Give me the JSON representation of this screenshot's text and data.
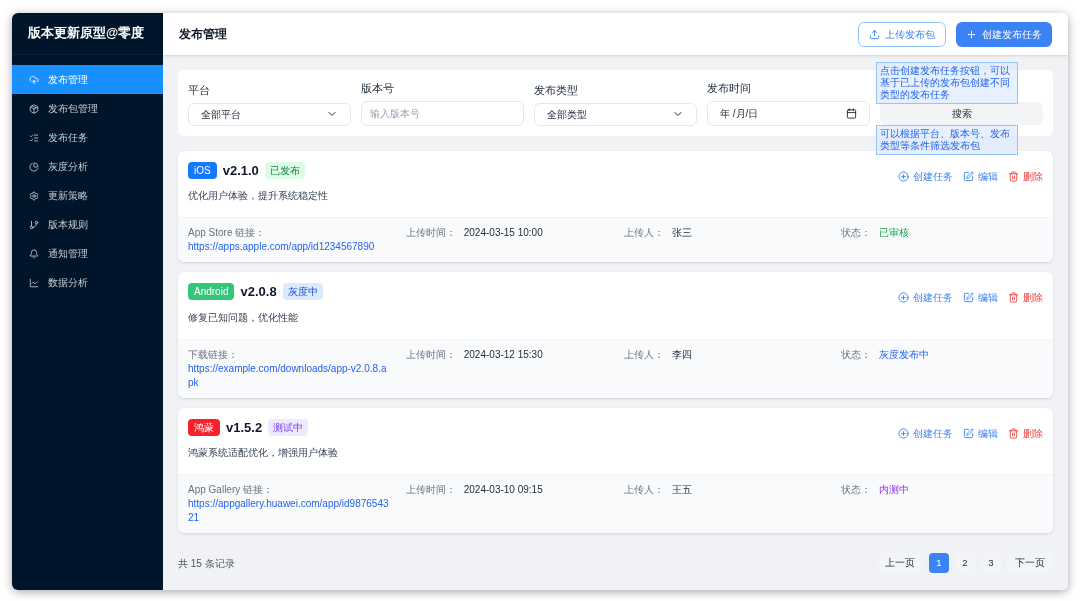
{
  "sidebar": {
    "title": "版本更新原型@零度",
    "items": [
      {
        "label": "发布管理",
        "kind": "upload",
        "selected": true
      },
      {
        "label": "发布包管理",
        "kind": "package",
        "selected": false
      },
      {
        "label": "发布任务",
        "kind": "tasks",
        "selected": false
      },
      {
        "label": "灰度分析",
        "kind": "pie",
        "selected": false
      },
      {
        "label": "更新策略",
        "kind": "gear",
        "selected": false
      },
      {
        "label": "版本规则",
        "kind": "branch",
        "selected": false
      },
      {
        "label": "通知管理",
        "kind": "bell",
        "selected": false
      },
      {
        "label": "数据分析",
        "kind": "chart",
        "selected": false
      }
    ]
  },
  "header": {
    "title": "发布管理",
    "buttons": [
      {
        "label": "上传发布包",
        "kind": "upload"
      },
      {
        "label": "创建发布任务",
        "kind": "create"
      }
    ]
  },
  "filters": {
    "fields": [
      {
        "label": "平台",
        "kind": "select",
        "value": "全部平台"
      },
      {
        "label": "版本号",
        "kind": "input",
        "placeholder": "输入版本号"
      },
      {
        "label": "发布类型",
        "kind": "select",
        "value": "全部类型"
      },
      {
        "label": "发布时间",
        "kind": "date",
        "placeholder": "年 /月/日"
      }
    ],
    "search_button": "搜索"
  },
  "annotations": [
    "点击创建发布任务按钮，可以基于已上传的发布包创建不同类型的发布任务",
    "可以根据平台、版本号、发布类型等条件筛选发布包"
  ],
  "releases": [
    {
      "platform": {
        "text": "iOS",
        "color": "#1677ff"
      },
      "version": "v2.1.0",
      "tag": {
        "text": "已发布",
        "kind": "released"
      },
      "description": "优化用户体验，提升系统稳定性",
      "actions": [
        {
          "label": "创建任务",
          "kind": "create"
        },
        {
          "label": "编辑",
          "kind": "edit"
        },
        {
          "label": "删除",
          "kind": "delete"
        }
      ],
      "link_label": "App Store 链接：",
      "link": "https://apps.apple.com/app/id1234567890",
      "time_label": "上传时间：",
      "time": "2024-03-15 10:00",
      "uploader_label": "上传人：",
      "uploader": "张三",
      "status_label": "状态：",
      "status": {
        "text": "已审核",
        "kind": "released"
      }
    },
    {
      "platform": {
        "text": "Android",
        "color": "#34c77b"
      },
      "version": "v2.0.8",
      "tag": {
        "text": "灰度中",
        "kind": "gray"
      },
      "description": "修复已知问题，优化性能",
      "actions": [
        {
          "label": "创建任务",
          "kind": "create"
        },
        {
          "label": "编辑",
          "kind": "edit"
        },
        {
          "label": "删除",
          "kind": "delete"
        }
      ],
      "link_label": "下载链接：",
      "link": "https://example.com/downloads/app-v2.0.8.apk",
      "time_label": "上传时间：",
      "time": "2024-03-12 15:30",
      "uploader_label": "上传人：",
      "uploader": "李四",
      "status_label": "状态：",
      "status": {
        "text": "灰度发布中",
        "kind": "gray"
      }
    },
    {
      "platform": {
        "text": "鸿蒙",
        "color": "#f5222d"
      },
      "version": "v1.5.2",
      "tag": {
        "text": "测试中",
        "kind": "testing"
      },
      "description": "鸿蒙系统适配优化，增强用户体验",
      "actions": [
        {
          "label": "创建任务",
          "kind": "create"
        },
        {
          "label": "编辑",
          "kind": "edit"
        },
        {
          "label": "删除",
          "kind": "delete"
        }
      ],
      "link_label": "App Gallery 链接：",
      "link": "https://appgallery.huawei.com/app/id987654321",
      "time_label": "上传时间：",
      "time": "2024-03-10 09:15",
      "uploader_label": "上传人：",
      "uploader": "王五",
      "status_label": "状态：",
      "status": {
        "text": "内测中",
        "kind": "testing"
      }
    }
  ],
  "footer": {
    "total": "共 15 条记录",
    "pages": [
      {
        "label": "上一页",
        "kind": "nav",
        "selected": false
      },
      {
        "label": "1",
        "kind": "page",
        "selected": true
      },
      {
        "label": "2",
        "kind": "page",
        "selected": false
      },
      {
        "label": "3",
        "kind": "page",
        "selected": false
      },
      {
        "label": "下一页",
        "kind": "nav",
        "selected": false
      }
    ]
  }
}
